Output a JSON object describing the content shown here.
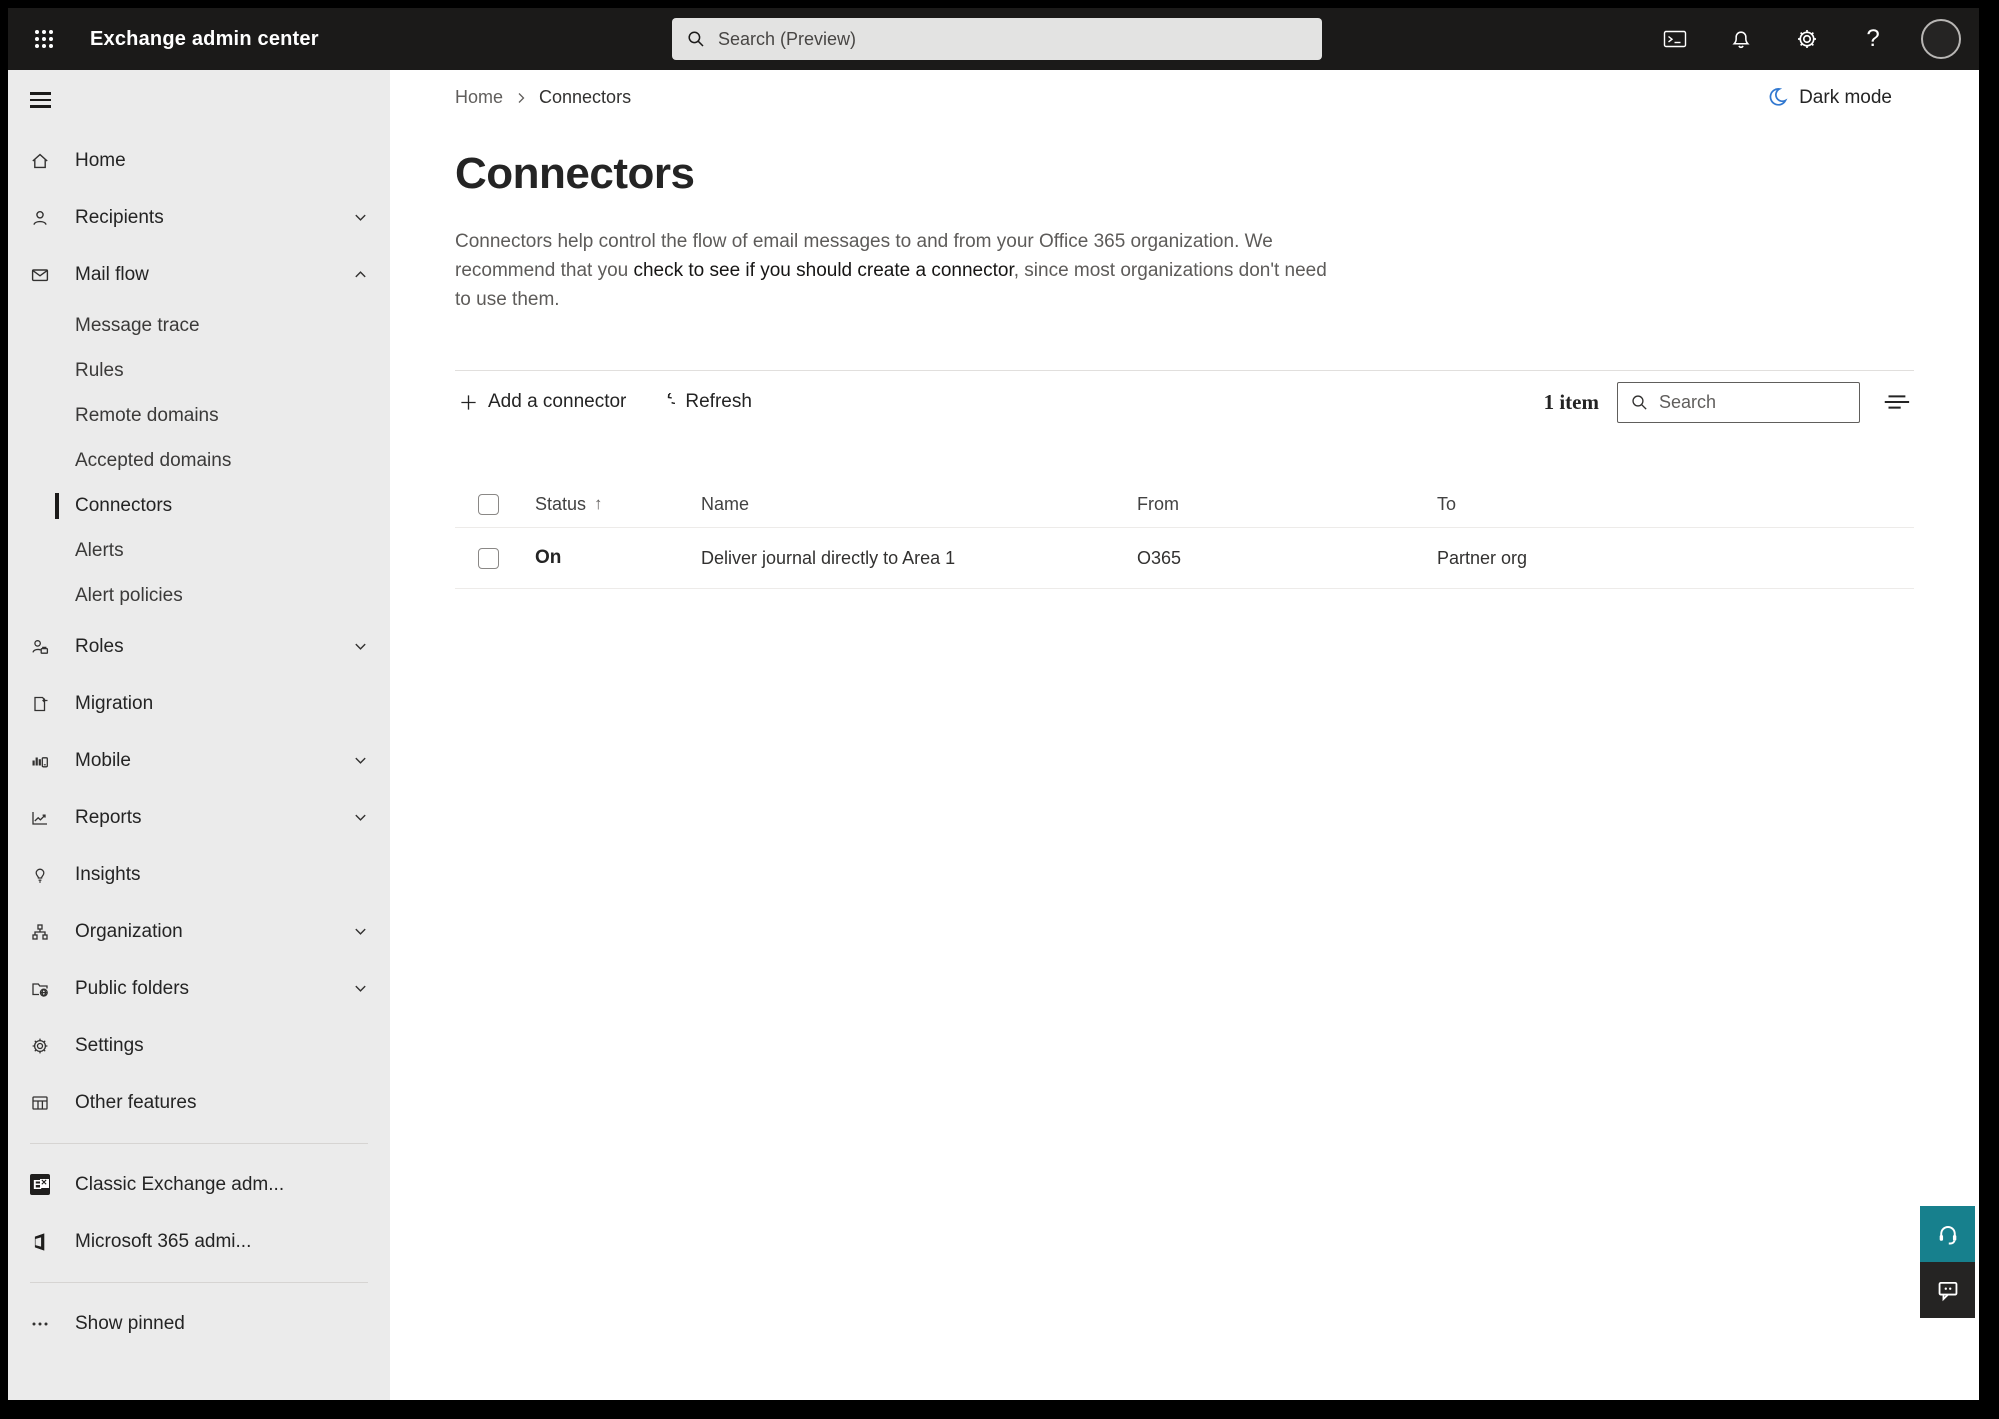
{
  "topbar": {
    "title": "Exchange admin center",
    "search_placeholder": "Search (Preview)"
  },
  "breadcrumb": {
    "home": "Home",
    "current": "Connectors"
  },
  "dark_mode": {
    "label": "Dark mode"
  },
  "page": {
    "title": "Connectors",
    "description_before": "Connectors help control the flow of email messages to and from your Office 365 organization. We recommend that you ",
    "description_link": "check to see if you should create a connector",
    "description_after": ", since most organizations don't need to use them."
  },
  "toolbar": {
    "add_label": "Add a connector",
    "refresh_label": "Refresh",
    "item_count": "1 item",
    "search_placeholder": "Search"
  },
  "table": {
    "columns": {
      "status": "Status",
      "name": "Name",
      "from": "From",
      "to": "To"
    },
    "sort_indicator": "↑",
    "rows": [
      {
        "status": "On",
        "name": "Deliver journal directly to Area 1",
        "from": "O365",
        "to": "Partner org"
      }
    ]
  },
  "sidebar": {
    "items": [
      {
        "label": "Home"
      },
      {
        "label": "Recipients"
      },
      {
        "label": "Mail flow"
      },
      {
        "label": "Roles"
      },
      {
        "label": "Migration"
      },
      {
        "label": "Mobile"
      },
      {
        "label": "Reports"
      },
      {
        "label": "Insights"
      },
      {
        "label": "Organization"
      },
      {
        "label": "Public folders"
      },
      {
        "label": "Settings"
      },
      {
        "label": "Other features"
      }
    ],
    "mail_flow_children": [
      {
        "label": "Message trace"
      },
      {
        "label": "Rules"
      },
      {
        "label": "Remote domains"
      },
      {
        "label": "Accepted domains"
      },
      {
        "label": "Connectors"
      },
      {
        "label": "Alerts"
      },
      {
        "label": "Alert policies"
      }
    ],
    "footer_items": [
      {
        "label": "Classic Exchange adm..."
      },
      {
        "label": "Microsoft 365 admi..."
      }
    ],
    "show_pinned_label": "Show pinned"
  },
  "icons": {
    "app_launcher": "waffle-grid",
    "terminal": "console-window",
    "notifications": "bell",
    "settings": "gear",
    "help": "question-mark",
    "account": "avatar-circle",
    "dark_mode": "crescent-moon",
    "add": "plus",
    "refresh": "circular-arrow",
    "search": "magnifier",
    "filter": "filter-lines",
    "support": "headset",
    "feedback": "chat-bubble",
    "sort": "arrow-up",
    "show_pinned": "ellipsis"
  },
  "colors": {
    "topbar_bg": "#1b1a19",
    "sidebar_bg": "#ebebeb",
    "moon_blue": "#3178d0",
    "support_teal": "#17808d",
    "feedback_dark": "#252423"
  }
}
